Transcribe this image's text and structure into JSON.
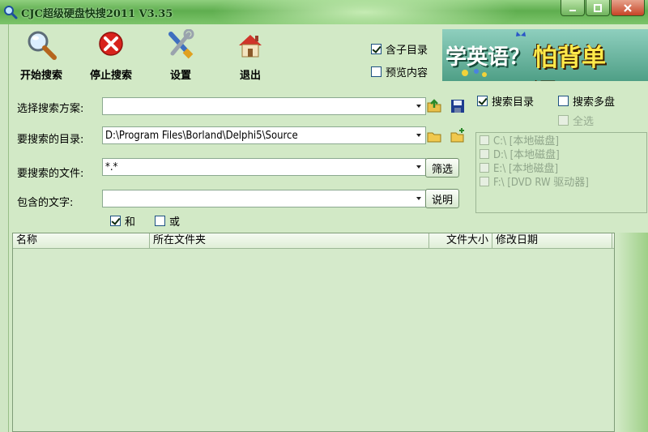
{
  "window": {
    "title": "CJC超级硬盘快搜2011 V3.35"
  },
  "toolbar": {
    "start": "开始搜索",
    "stop": "停止搜索",
    "settings": "设置",
    "exit": "退出"
  },
  "options": {
    "include_subdirs": {
      "label": "含子目录",
      "checked": true
    },
    "preview_content": {
      "label": "预览内容",
      "checked": false
    }
  },
  "banner": {
    "part1": "学英语？",
    "part2": "怕背单词？"
  },
  "form": {
    "scheme_label": "选择搜索方案:",
    "scheme_value": "",
    "dir_label": "要搜索的目录:",
    "dir_value": "D:\\Program Files\\Borland\\Delphi5\\Source",
    "file_label": "要搜索的文件:",
    "file_value": "*.*",
    "filter_button": "筛选",
    "text_label": "包含的文字:",
    "text_value": "",
    "help_button": "说明",
    "and_label": "和",
    "or_label": "或"
  },
  "right_panel": {
    "search_dir": {
      "label": "搜索目录",
      "checked": true
    },
    "multi_disk": {
      "label": "搜索多盘",
      "checked": false
    },
    "select_all": {
      "label": "全选",
      "checked": false
    },
    "drives": [
      "C:\\ [本地磁盘]",
      "D:\\ [本地磁盘]",
      "E:\\ [本地磁盘]",
      "F:\\ [DVD RW 驱动器]"
    ]
  },
  "results": {
    "columns": [
      "名称",
      "所在文件夹",
      "文件大小",
      "修改日期"
    ]
  },
  "colors": {
    "window_bg": "#d2e9c6",
    "titlebar": "#6fb35c",
    "close_button": "#c64326"
  }
}
